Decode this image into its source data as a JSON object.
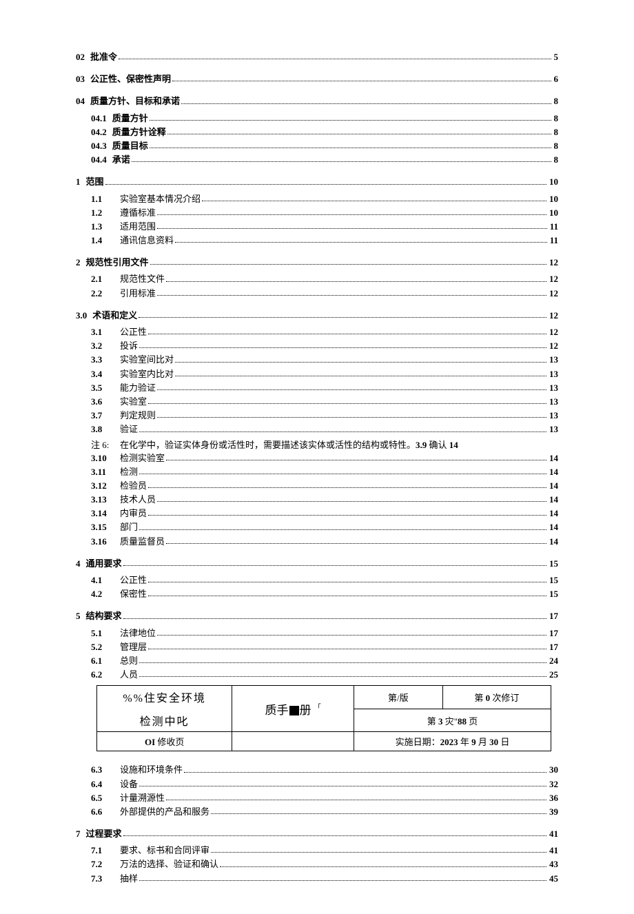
{
  "toc_top": [
    {
      "type": "l0",
      "num": "02",
      "label": "批准令",
      "page": "5"
    },
    {
      "type": "l0",
      "num": "03",
      "label": "公正性、保密性声明",
      "page": "6"
    },
    {
      "type": "l0",
      "num": "04",
      "label": "质量方针、目标和承诺",
      "page": "8"
    },
    {
      "type": "l04",
      "num": "04.1",
      "label": "质量方针",
      "page": "8"
    },
    {
      "type": "l04",
      "num": "04.2",
      "label": "质量方针诠释",
      "page": "8"
    },
    {
      "type": "l04",
      "num": "04.3",
      "label": "质量目标",
      "page": "8"
    },
    {
      "type": "l04",
      "num": "04.4",
      "label": "承诺",
      "page": "8"
    },
    {
      "type": "l0",
      "num": "1",
      "label": "范围",
      "page": "10"
    },
    {
      "type": "l1",
      "num": "1.1",
      "label": "实验室基本情况介绍",
      "page": "10"
    },
    {
      "type": "l1",
      "num": "1.2",
      "label": "遵循标准",
      "page": "10"
    },
    {
      "type": "l1",
      "num": "1.3",
      "label": "适用范围",
      "page": "11"
    },
    {
      "type": "l1",
      "num": "1.4",
      "label": "通讯信息资料",
      "page": "11"
    },
    {
      "type": "l0",
      "num": "2",
      "label": "规范性引用文件",
      "page": "12"
    },
    {
      "type": "l1",
      "num": "2.1",
      "label": "规范性文件",
      "page": "12"
    },
    {
      "type": "l1",
      "num": "2.2",
      "label": "引用标准",
      "page": "12"
    },
    {
      "type": "l0",
      "num": "3.0",
      "label": "术语和定义",
      "page": "12"
    },
    {
      "type": "l1",
      "num": "3.1",
      "label": "公正性",
      "page": "12"
    },
    {
      "type": "l1",
      "num": "3.2",
      "label": "投诉",
      "page": "12"
    },
    {
      "type": "l1",
      "num": "3.3",
      "label": "实验室间比对",
      "page": "13"
    },
    {
      "type": "l1",
      "num": "3.4",
      "label": "实验室内比对",
      "page": "13"
    },
    {
      "type": "l1",
      "num": "3.5",
      "label": "能力验证",
      "page": "13"
    },
    {
      "type": "l1",
      "num": "3.6",
      "label": "实验室",
      "page": "13"
    },
    {
      "type": "l1",
      "num": "3.7",
      "label": "判定规则",
      "page": "13"
    },
    {
      "type": "l1",
      "num": "3.8",
      "label": "验证",
      "page": "13"
    },
    {
      "type": "note",
      "num": "注 6:",
      "label_pre": "在化学中，验证实体身份或活性时，需要描述该实体或活性的结构或特性。",
      "bold1": "3.9",
      "label_post": " 确认 ",
      "bold2": "14"
    },
    {
      "type": "l1",
      "num": "3.10",
      "label": "检测实验室",
      "page": "14"
    },
    {
      "type": "l1",
      "num": "3.11",
      "label": "检测",
      "page": "14"
    },
    {
      "type": "l1",
      "num": "3.12",
      "label": "检验员",
      "page": "14"
    },
    {
      "type": "l1",
      "num": "3.13",
      "label": "技术人员",
      "page": "14"
    },
    {
      "type": "l1",
      "num": "3.14",
      "label": "内审员",
      "page": "14"
    },
    {
      "type": "l1",
      "num": "3.15",
      "label": "部门",
      "page": "14"
    },
    {
      "type": "l1",
      "num": "3.16",
      "label": "质量监督员",
      "page": "14"
    },
    {
      "type": "l0",
      "num": "4",
      "label": "通用要求",
      "page": "15"
    },
    {
      "type": "l1",
      "num": "4.1",
      "label": "公正性",
      "page": "15"
    },
    {
      "type": "l1",
      "num": "4.2",
      "label": "保密性",
      "page": "15"
    },
    {
      "type": "l0",
      "num": "5",
      "label": "结构要求",
      "page": "17"
    },
    {
      "type": "l1",
      "num": "5.1",
      "label": "法律地位",
      "page": "17"
    },
    {
      "type": "l1",
      "num": "5.2",
      "label": "管理层",
      "page": "17"
    },
    {
      "type": "l1",
      "num": "6.1",
      "label": "总则",
      "page": "24"
    },
    {
      "type": "l1",
      "num": "6.2",
      "label": "人员",
      "page": "25"
    }
  ],
  "table": {
    "r1c1a": "%%住安全环境",
    "r1c1b": "检测中叱",
    "r1c2_pre": "质手",
    "r1c2_post": "册",
    "r1c2_sup": "「",
    "r1c3": "第/版",
    "r1c4_pre": "第 ",
    "r1c4_b": "0",
    "r1c4_post": " 次修订",
    "r2c3_pre": "第 ",
    "r2c3_b1": "3",
    "r2c3_mid": " 灾\"",
    "r2c3_b2": "88",
    "r2c3_post": " 页",
    "r3c1_pre": "OI ",
    "r3c1_post": "修收页",
    "r3c3_pre": "实施日期：",
    "r3c3_b": "2023",
    "r3c3_mid1": " 年 ",
    "r3c3_b2": "9",
    "r3c3_mid2": " 月 ",
    "r3c3_b3": "30",
    "r3c3_post": " 日"
  },
  "toc_bottom": [
    {
      "type": "l1",
      "num": "6.3",
      "label": "设施和环境条件",
      "page": "30"
    },
    {
      "type": "l1",
      "num": "6.4",
      "label": "设备",
      "page": "32"
    },
    {
      "type": "l1",
      "num": "6.5",
      "label": "计量溯源性",
      "page": "36"
    },
    {
      "type": "l1",
      "num": "6.6",
      "label": "外部提供的产品和服务",
      "page": "39"
    },
    {
      "type": "l0",
      "num": "7",
      "label": "过程要求",
      "page": "41"
    },
    {
      "type": "l1",
      "num": "7.1",
      "label": "要求、标书和合同评审",
      "page": "41"
    },
    {
      "type": "l1",
      "num": "7.2",
      "label": "万法的选择、验证和确认",
      "page": "43"
    },
    {
      "type": "l1",
      "num": "7.3",
      "label": "抽样",
      "page": "45"
    }
  ]
}
